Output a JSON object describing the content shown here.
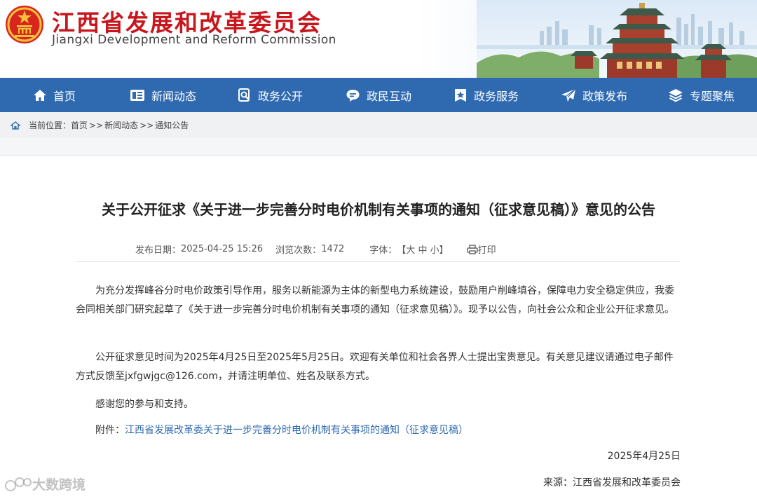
{
  "header": {
    "title": "江西省发展和改革委员会",
    "subtitle": "Jiangxi Development and Reform Commission"
  },
  "nav": {
    "items": [
      {
        "label": "首页",
        "icon": "home-icon"
      },
      {
        "label": "新闻动态",
        "icon": "news-icon"
      },
      {
        "label": "政务公开",
        "icon": "search-doc-icon"
      },
      {
        "label": "政民互动",
        "icon": "chat-icon"
      },
      {
        "label": "政务服务",
        "icon": "star-badge-icon"
      },
      {
        "label": "政策发布",
        "icon": "paper-plane-icon"
      },
      {
        "label": "专题聚焦",
        "icon": "layers-icon"
      }
    ]
  },
  "breadcrumb": {
    "prefix": "当前位置：",
    "items": [
      "首页",
      "新闻动态",
      "通知公告"
    ],
    "separator": ">>"
  },
  "article": {
    "title": "关于公开征求《关于进一步完善分时电价机制有关事项的通知（征求意见稿）》意见的公告",
    "publish_label": "发布日期：",
    "publish_date": "2025-04-25 15:26",
    "views_label": "浏览次数：",
    "views": "1472",
    "font_label": "字体：",
    "font_open": "【",
    "font_large": "大",
    "font_medium": "中",
    "font_small": "小",
    "font_close": "】",
    "print_label": "打印",
    "paragraphs": [
      "为充分发挥峰谷分时电价政策引导作用，服务以新能源为主体的新型电力系统建设，鼓励用户削峰填谷，保障电力安全稳定供应，我委会同相关部门研究起草了《关于进一步完善分时电价机制有关事项的通知（征求意见稿）》。现予以公告，向社会公众和企业公开征求意见。",
      "公开征求意见时间为2025年4月25日至2025年5月25日。欢迎有关单位和社会各界人士提出宝贵意见。有关意见建议请通过电子邮件方式反馈至jxfgwjgc@126.com，并请注明单位、姓名及联系方式。",
      "感谢您的参与和支持。"
    ],
    "attachment_label": "附件：",
    "attachment_link": "江西省发展改革委关于进一步完善分时电价机制有关事项的通知（征求意见稿）",
    "date": "2025年4月25日",
    "source": "来源：江西省发展和改革委员会"
  },
  "watermark": "大数跨境",
  "colors": {
    "brand_red": "#c8161d",
    "nav_blue": "#2f6ab1",
    "link_blue": "#2f6ab1"
  }
}
